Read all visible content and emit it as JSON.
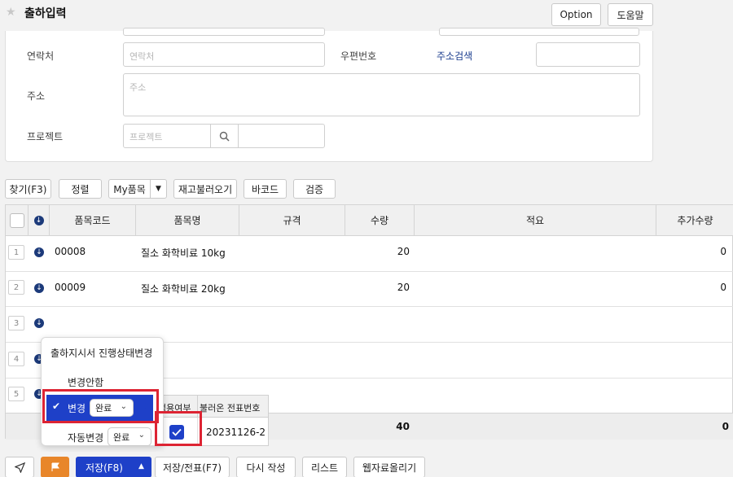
{
  "header": {
    "title": "출하입력",
    "option_label": "Option",
    "help_label": "도움말"
  },
  "form": {
    "contact_label": "연락처",
    "contact_placeholder": "연락처",
    "postcode_label": "우편번호",
    "address_search_label": "주소검색",
    "address_label": "주소",
    "address_placeholder": "주소",
    "project_label": "프로젝트",
    "project_placeholder": "프로젝트"
  },
  "toolbar": {
    "find_label": "찾기(F3)",
    "sort_label": "정렬",
    "myitems_label": "My품목",
    "reload_stock_label": "재고불러오기",
    "barcode_label": "바코드",
    "verify_label": "검증"
  },
  "grid": {
    "columns": [
      "품목코드",
      "품목명",
      "규격",
      "수량",
      "적요",
      "추가수량"
    ],
    "rows": [
      {
        "num": "1",
        "code": "00008",
        "name": "질소 화학비료 10kg",
        "qty": "20",
        "extra": "0"
      },
      {
        "num": "2",
        "code": "00009",
        "name": "질소 화학비료 20kg",
        "qty": "20",
        "extra": "0"
      },
      {
        "num": "3"
      },
      {
        "num": "4"
      },
      {
        "num": "5"
      }
    ],
    "total_qty": "40",
    "total_extra": "0"
  },
  "popup": {
    "title": "출하지시서 진행상태변경",
    "no_change_label": "변경안함",
    "change_label": "변경",
    "change_value": "완료",
    "auto_change_label": "자동변경",
    "auto_change_value": "완료"
  },
  "subpanel": {
    "col_apply": "적용여부",
    "col_voucher": "불러온 전표번호",
    "voucher_no": "20231126-2"
  },
  "bottom": {
    "save_label": "저장(F8)",
    "save_voucher_label": "저장/전표(F7)",
    "rewrite_label": "다시 작성",
    "list_label": "리스트",
    "web_upload_label": "웹자료올리기"
  },
  "colors": {
    "accent_blue": "#1e40c8",
    "flag_orange": "#e8862a",
    "highlight_red": "#dd2433"
  }
}
